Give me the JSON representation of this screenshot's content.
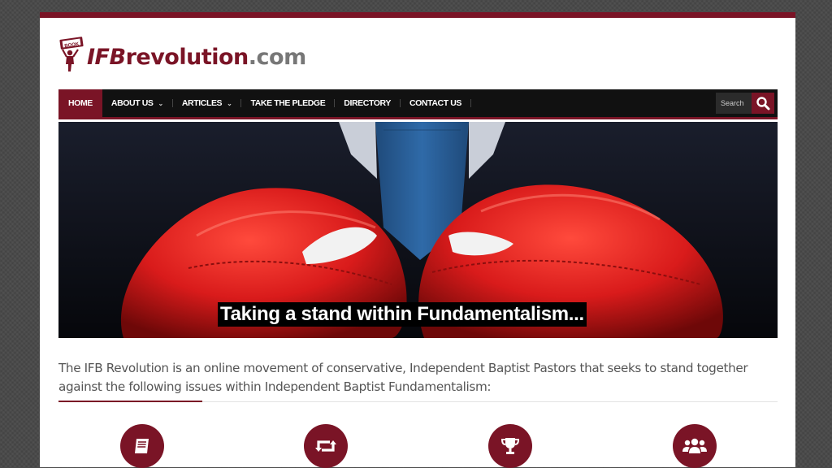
{
  "site": {
    "logo_main": "IFBrevolution",
    "logo_suffix": ".com",
    "logo_book_label": "BOOK"
  },
  "nav": {
    "items": [
      {
        "label": "HOME",
        "active": true
      },
      {
        "label": "ABOUT US",
        "has_dropdown": true
      },
      {
        "label": "ARTICLES",
        "has_dropdown": true
      },
      {
        "label": "TAKE THE PLEDGE"
      },
      {
        "label": "DIRECTORY"
      },
      {
        "label": "CONTACT US"
      }
    ],
    "search_placeholder": "Search",
    "search_icon": "magnifier-icon"
  },
  "hero": {
    "caption": "Taking a stand within Fundamentalism..."
  },
  "intro": {
    "text": "The IFB Revolution is an online movement of conservative, Independent Baptist Pastors that seeks to stand together against the following issues within Independent Baptist Fundamentalism:"
  },
  "features": [
    {
      "icon": "book-icon"
    },
    {
      "icon": "retweet-icon"
    },
    {
      "icon": "trophy-icon"
    },
    {
      "icon": "users-icon"
    }
  ],
  "colors": {
    "accent": "#7a1426",
    "nav_bg": "#111111",
    "background": "#4a4a4a",
    "glove_red": "#d81f1f"
  }
}
